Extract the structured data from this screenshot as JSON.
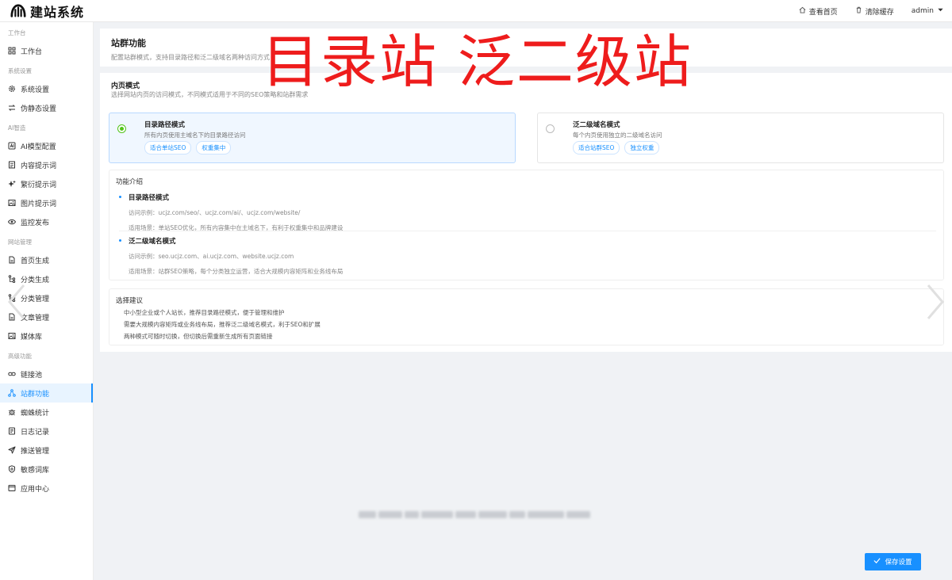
{
  "topbar": {
    "logo_text": "建站系统",
    "actions": [
      {
        "label": "查看首页",
        "icon": "home-icon"
      },
      {
        "label": "清除缓存",
        "icon": "trash-icon"
      },
      {
        "label": "admin",
        "icon": "caret-down-icon"
      }
    ]
  },
  "sidebar": {
    "groups": [
      {
        "label": "工作台",
        "items": [
          {
            "label": "工作台",
            "icon": "grid-icon"
          }
        ]
      },
      {
        "label": "系统设置",
        "items": [
          {
            "label": "系统设置",
            "icon": "gear-icon"
          },
          {
            "label": "伪静态设置",
            "icon": "swap-icon"
          }
        ]
      },
      {
        "label": "AI智造",
        "items": [
          {
            "label": "AI模型配置",
            "icon": "ai-icon"
          },
          {
            "label": "内容提示词",
            "icon": "document-icon"
          },
          {
            "label": "繁衍提示词",
            "icon": "sparkle-icon"
          },
          {
            "label": "图片提示词",
            "icon": "image-icon"
          },
          {
            "label": "监控发布",
            "icon": "eye-icon"
          }
        ]
      },
      {
        "label": "网站管理",
        "items": [
          {
            "label": "首页生成",
            "icon": "file-icon"
          },
          {
            "label": "分类生成",
            "icon": "branch-icon"
          },
          {
            "label": "分类管理",
            "icon": "branch-icon"
          },
          {
            "label": "文章管理",
            "icon": "file-icon"
          },
          {
            "label": "媒体库",
            "icon": "image-icon"
          }
        ]
      },
      {
        "label": "高级功能",
        "items": [
          {
            "label": "链接池",
            "icon": "link-icon"
          },
          {
            "label": "站群功能",
            "icon": "network-icon",
            "active": true
          },
          {
            "label": "蜘蛛统计",
            "icon": "bug-icon"
          },
          {
            "label": "日志记录",
            "icon": "log-icon"
          },
          {
            "label": "推送管理",
            "icon": "send-icon"
          },
          {
            "label": "敏感词库",
            "icon": "shield-icon"
          },
          {
            "label": "应用中心",
            "icon": "app-icon"
          }
        ]
      }
    ]
  },
  "header": {
    "title": "站群功能",
    "subtitle": "配置站群模式，支持目录路径和泛二级域名两种访问方式"
  },
  "overlay_text": "目录站  泛二级站",
  "page_mode": {
    "title": "内页模式",
    "desc": "选择网站内页的访问模式，不同模式适用于不同的SEO策略和站群需求",
    "options": [
      {
        "name": "目录路径模式",
        "desc": "所有内页使用主域名下的目录路径访问",
        "tags": [
          "适合单站SEO",
          "权重集中"
        ],
        "selected": true
      },
      {
        "name": "泛二级域名模式",
        "desc": "每个内页使用独立的二级域名访问",
        "tags": [
          "适合站群SEO",
          "独立权重"
        ],
        "selected": false
      }
    ]
  },
  "intro": {
    "title": "功能介绍",
    "items": [
      {
        "name": "目录路径模式",
        "example": "访问示例：ucjz.com/seo/、ucjz.com/ai/、ucjz.com/website/",
        "scene": "适用场景：单站SEO优化，所有内容集中在主域名下，有利于权重集中和品牌建设"
      },
      {
        "name": "泛二级域名模式",
        "example": "访问示例：seo.ucjz.com、ai.ucjz.com、website.ucjz.com",
        "scene": "适用场景：站群SEO策略，每个分类独立运营，适合大规模内容矩阵和业务线布局"
      }
    ]
  },
  "advice": {
    "title": "选择建议",
    "lines": [
      "中小型企业或个人站长，推荐目录路径模式，便于管理和维护",
      "需要大规模内容矩阵或业务线布局，推荐泛二级域名模式，利于SEO和扩展",
      "两种模式可随时切换，但切换后需重新生成所有页面链接"
    ]
  },
  "save_button": "保存设置",
  "colors": {
    "primary": "#1890ff",
    "overlay": "#ee1c1c",
    "radio_checked": "#52c41a"
  }
}
